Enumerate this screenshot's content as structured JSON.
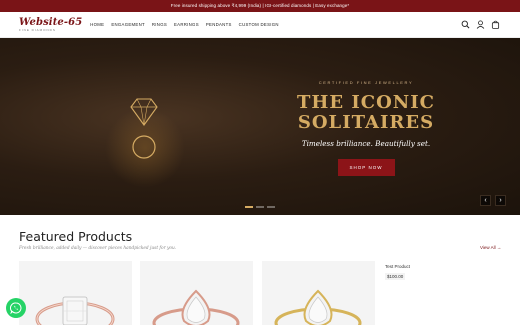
{
  "announcement": "Free insured shipping above ₹4,999 (India) | IGI-certified diamonds | Easy exchange*",
  "logo": {
    "main": "Website-65",
    "sub": "FINE DIAMONDS"
  },
  "nav": [
    "HOME",
    "ENGAGEMENT",
    "RINGS",
    "EARRINGS",
    "PENDANTS",
    "CUSTOM DESIGN"
  ],
  "header_icons": [
    "search-icon",
    "user-icon",
    "cart-icon"
  ],
  "hero": {
    "eyebrow": "CERTIFIED FINE JEWELLERY",
    "title_line1": "THE ICONIC",
    "title_line2": "SOLITAIRES",
    "subtitle": "Timeless brilliance. Beautifully set.",
    "button": "SHOP NOW",
    "prev": "‹",
    "next": "›",
    "slides": 3,
    "active_slide": 1
  },
  "featured": {
    "title": "Featured Products",
    "subtitle": "Fresh brilliance, added daily — discover pieces handpicked just for you.",
    "view_all": "View All →",
    "products": [
      {
        "metal": "rose gold",
        "shape": "emerald-cut"
      },
      {
        "metal": "rose gold",
        "shape": "pear-halo"
      },
      {
        "metal": "yellow gold",
        "shape": "pear-halo"
      }
    ],
    "text_product": {
      "name": "Test Product",
      "price": "$100.00"
    }
  },
  "colors": {
    "brand": "#7a1417",
    "gold": "#d5ab63",
    "hero_bg": "#2b1d12",
    "whatsapp": "#25d366"
  }
}
